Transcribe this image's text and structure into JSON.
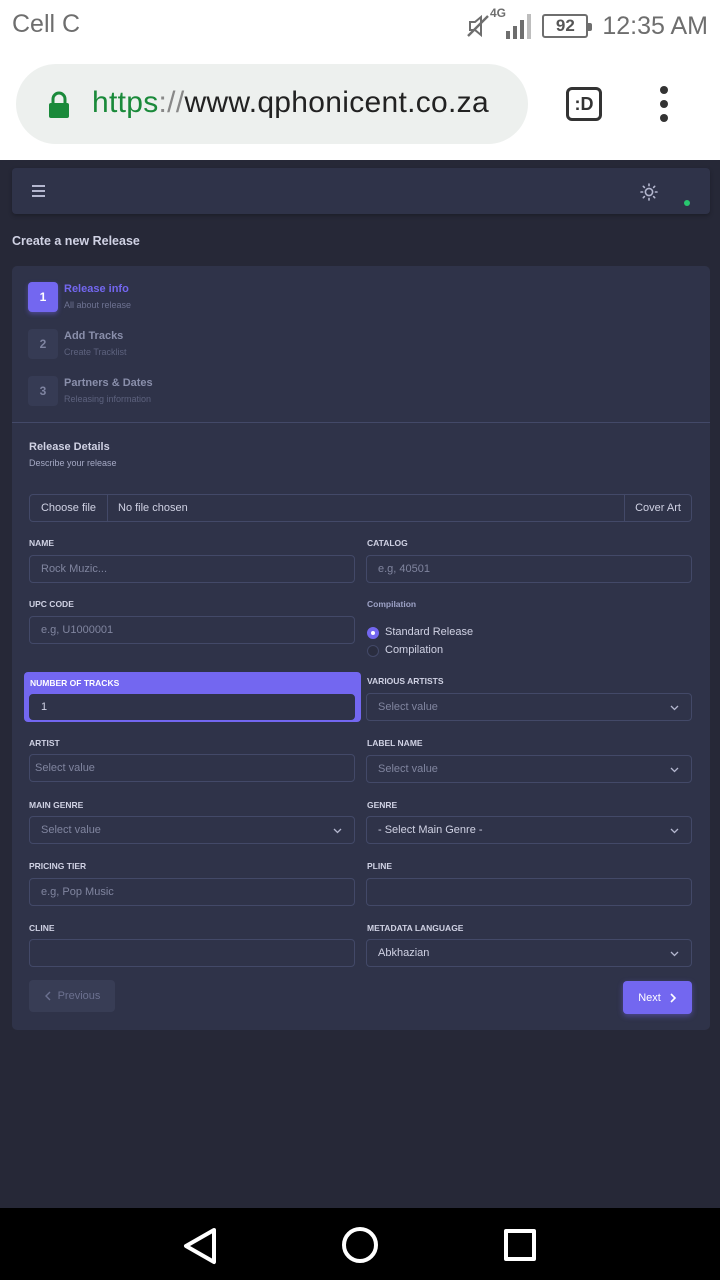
{
  "status_bar": {
    "carrier": "Cell C",
    "network": "4G",
    "battery": "92",
    "time": "12:35 AM",
    "icons": [
      "mute-icon",
      "signal-icon",
      "battery-icon"
    ]
  },
  "browser": {
    "url_scheme": "https",
    "url_sep": "://",
    "url_host": "www.qphonicent.co.za",
    "tabs_label": ":D"
  },
  "app": {
    "page_title": "Create a new Release",
    "steps": [
      {
        "num": "1",
        "title": "Release info",
        "subtitle": "All about release",
        "active": true
      },
      {
        "num": "2",
        "title": "Add Tracks",
        "subtitle": "Create Tracklist",
        "active": false
      },
      {
        "num": "3",
        "title": "Partners & Dates",
        "subtitle": "Releasing information",
        "active": false
      }
    ],
    "section": {
      "title": "Release Details",
      "subtitle": "Describe your release"
    },
    "file": {
      "button": "Choose file",
      "status": "No file chosen",
      "addon": "Cover Art"
    },
    "fields": {
      "name": {
        "label": "NAME",
        "placeholder": "Rock Muzic..."
      },
      "catalog": {
        "label": "CATALOG",
        "placeholder": "e.g, 40501"
      },
      "upc": {
        "label": "UPC CODE",
        "placeholder": "e.g, U1000001"
      },
      "compilation": {
        "label": "Compilation",
        "options": [
          "Standard Release",
          "Compilation"
        ],
        "selected": "Standard Release"
      },
      "tracks": {
        "label": "NUMBER OF TRACKS",
        "value": "1"
      },
      "various_artists": {
        "label": "VARIOUS ARTISTS",
        "placeholder": "Select value"
      },
      "artist": {
        "label": "ARTIST",
        "placeholder": "Select value"
      },
      "label_name": {
        "label": "LABEL NAME",
        "placeholder": "Select value"
      },
      "main_genre": {
        "label": "MAIN GENRE",
        "placeholder": "Select value"
      },
      "genre": {
        "label": "GENRE",
        "value": "- Select Main Genre -"
      },
      "pricing_tier": {
        "label": "PRICING TIER",
        "placeholder": "e.g, Pop Music"
      },
      "pline": {
        "label": "PLINE",
        "value": ""
      },
      "cline": {
        "label": "CLINE",
        "value": ""
      },
      "metadata_language": {
        "label": "METADATA LANGUAGE",
        "value": "Abkhazian"
      }
    },
    "buttons": {
      "previous": "Previous",
      "next": "Next"
    },
    "colors": {
      "accent": "#7367f0",
      "background": "#262837",
      "card": "#2f3349",
      "online": "#28c76f"
    }
  }
}
